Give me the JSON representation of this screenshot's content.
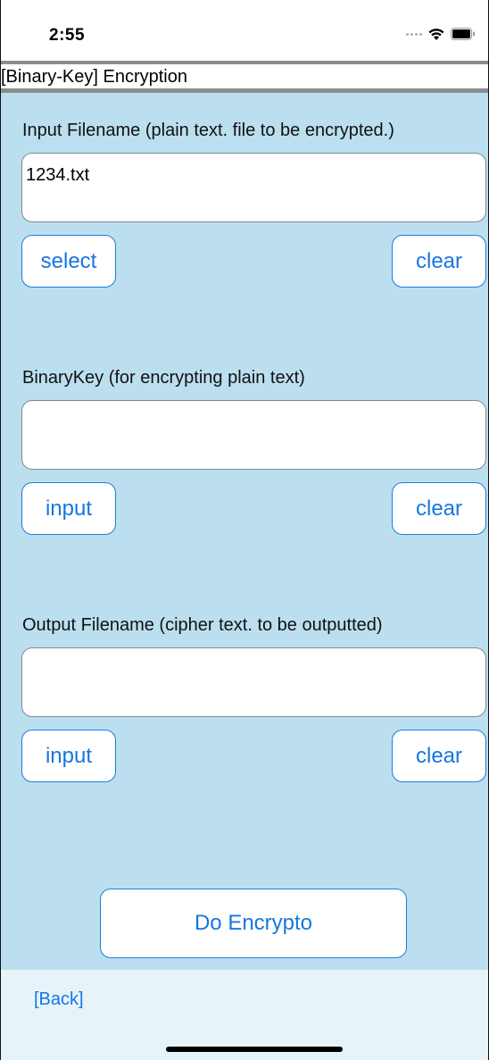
{
  "status_bar": {
    "time": "2:55",
    "icons": [
      "signal-dots-icon",
      "wifi-icon",
      "battery-icon"
    ]
  },
  "title": "[Binary-Key] Encryption",
  "sections": [
    {
      "label": "Input Filename (plain text. file to be encrypted.)",
      "field_value": "1234.txt",
      "left_button": "select",
      "right_button": "clear"
    },
    {
      "label": "BinaryKey (for encrypting plain text)",
      "field_value": "",
      "left_button": "input",
      "right_button": "clear"
    },
    {
      "label": "Output Filename (cipher text. to be outputted)",
      "field_value": "",
      "left_button": "input",
      "right_button": "clear"
    }
  ],
  "action_button": "Do Encrypto",
  "back_link": "[Back]",
  "colors": {
    "background": "#bbdfef",
    "accent": "#1776e1",
    "bottom_area": "#e6f4fa",
    "title_border": "#8c8c8c"
  }
}
